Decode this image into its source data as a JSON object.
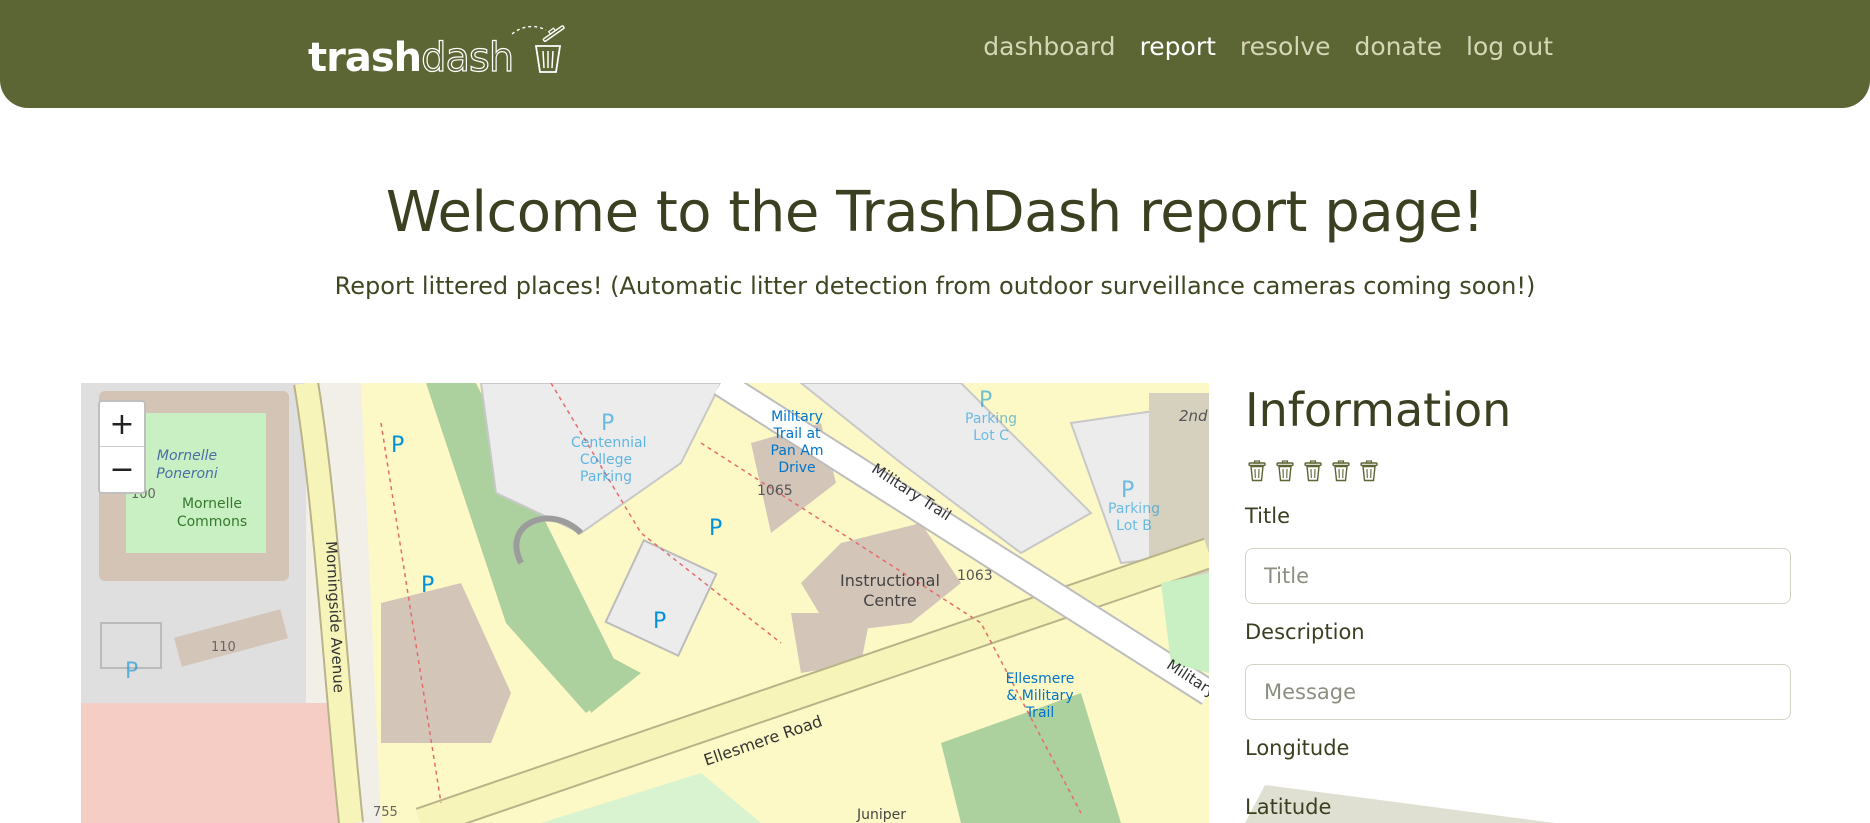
{
  "app": {
    "logo_part1": "trash",
    "logo_part2": "dash"
  },
  "nav": {
    "items": [
      {
        "label": "dashboard",
        "active": false
      },
      {
        "label": "report",
        "active": true
      },
      {
        "label": "resolve",
        "active": false
      },
      {
        "label": "donate",
        "active": false
      },
      {
        "label": "log out",
        "active": false
      }
    ]
  },
  "hero": {
    "title": "Welcome to the TrashDash report page!",
    "subtitle": "Report littered places! (Automatic litter detection from outdoor surveillance cameras coming soon!)"
  },
  "map": {
    "zoom_in": "+",
    "zoom_out": "−",
    "labels": {
      "centennial_parking": "Centennial College Parking",
      "military_trail_pan_am": "Military Trail at Pan Am Drive",
      "building_1065": "1065",
      "building_1063": "1063",
      "military_trail": "Military Trail",
      "instructional_centre": "Instructional Centre",
      "morningside_avenue": "Morningside Avenue",
      "mornelle_poneroni": "Mornelle Poneroni",
      "mornelle_commons": "Mornelle Commons",
      "num_100": "100",
      "num_110": "110",
      "num_755": "755",
      "ellesmere_road": "Ellesmere Road",
      "ellesmere_military_trail": "Ellesmere & Military Trail",
      "parking_lot_c": "Parking Lot C",
      "parking_lot_b": "Parking Lot B",
      "juniper": "Juniper",
      "second": "2nd",
      "parking_symbol": "P"
    }
  },
  "form": {
    "heading": "Information",
    "rating_icon_count": 5,
    "title_label": "Title",
    "title_placeholder": "Title",
    "title_value": "",
    "description_label": "Description",
    "description_placeholder": "Message",
    "description_value": "",
    "longitude_label": "Longitude",
    "latitude_label": "Latitude"
  },
  "colors": {
    "brand": "#5c6534",
    "text_dark": "#3a4020",
    "nav_inactive": "#d4d6b5"
  },
  "icons": [
    "trash-bin-icon",
    "rating-trash-bin-icon"
  ]
}
